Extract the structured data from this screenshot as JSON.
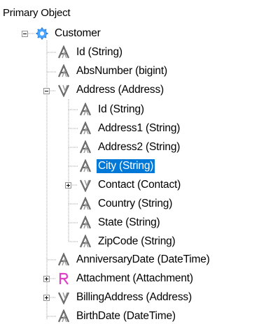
{
  "header": {
    "title": "Primary Object"
  },
  "tree": {
    "root": {
      "label": "Customer",
      "icon": "gear-class-icon",
      "expanded": true
    },
    "items": [
      {
        "label": "Id (String)",
        "icon": "string-property-icon"
      },
      {
        "label": "AbsNumber (bigint)",
        "icon": "string-property-icon"
      },
      {
        "label": "Address (Address)",
        "icon": "reference-property-icon",
        "expanded": true
      },
      {
        "label": "Id (String)",
        "icon": "string-property-icon"
      },
      {
        "label": "Address1 (String)",
        "icon": "string-property-icon"
      },
      {
        "label": "Address2 (String)",
        "icon": "string-property-icon"
      },
      {
        "label": "City (String)",
        "icon": "string-property-icon",
        "selected": true
      },
      {
        "label": "Contact (Contact)",
        "icon": "reference-property-icon",
        "expanded": false
      },
      {
        "label": "Country (String)",
        "icon": "string-property-icon"
      },
      {
        "label": "State (String)",
        "icon": "string-property-icon"
      },
      {
        "label": "ZipCode (String)",
        "icon": "string-property-icon"
      },
      {
        "label": "AnniversaryDate (DateTime)",
        "icon": "string-property-icon"
      },
      {
        "label": "Attachment (Attachment)",
        "icon": "attachment-property-icon",
        "expanded": false
      },
      {
        "label": "BillingAddress (Address)",
        "icon": "reference-property-icon",
        "expanded": false
      },
      {
        "label": "BirthDate (DateTime)",
        "icon": "string-property-icon"
      }
    ]
  },
  "colors": {
    "selection": "#0078d7",
    "treeLine": "#a0a0a0",
    "iconGray": "#6b6b6b",
    "gearBlue": "#4aa3ff",
    "attachmentPink": "#e040c8"
  }
}
